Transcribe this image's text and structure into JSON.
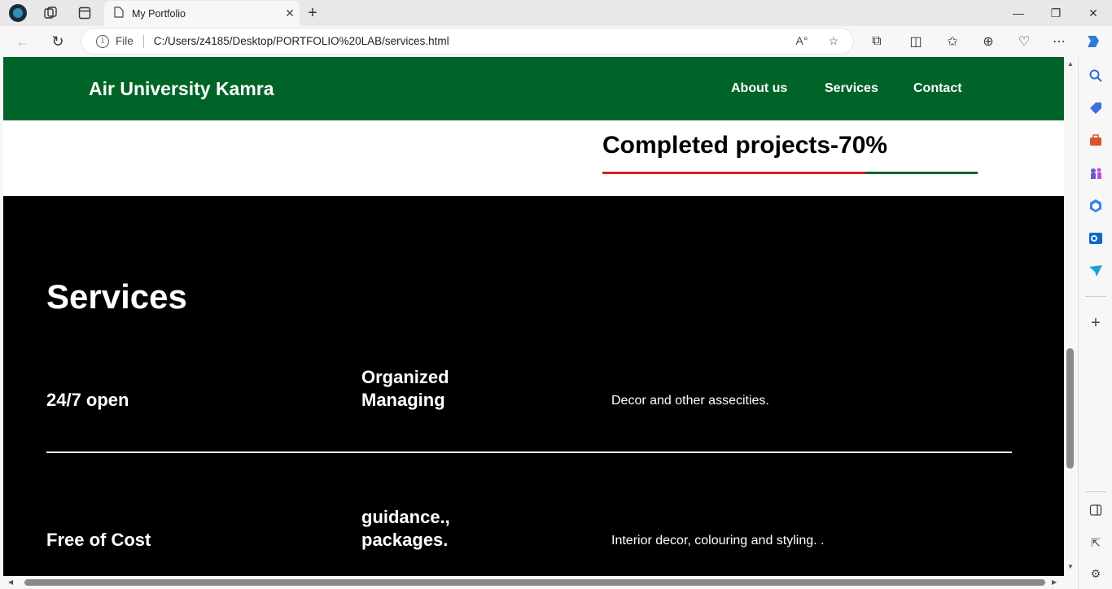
{
  "browser": {
    "tab_title": "My Portfolio",
    "address_label": "File",
    "url": "C:/Users/z4185/Desktop/PORTFOLIO%20LAB/services.html"
  },
  "site": {
    "brand": "Air University Kamra",
    "nav": [
      "About us",
      "Services",
      "Contact"
    ]
  },
  "progress": {
    "title": "Completed projects-70%",
    "value": 0.7,
    "fill_color": "#d32020",
    "track_color": "#006428"
  },
  "services": {
    "heading": "Services",
    "rows": [
      {
        "title": "24/7 open",
        "subtitle_line1": "Organized",
        "subtitle_line2": "Managing",
        "description": "Decor and other assecities."
      },
      {
        "title": "Free of Cost",
        "subtitle_line1": "guidance.,",
        "subtitle_line2": "packages.",
        "description": "Interior decor, colouring and styling. ."
      }
    ]
  },
  "colors": {
    "navbar": "#006428",
    "services_bg": "#000000"
  }
}
